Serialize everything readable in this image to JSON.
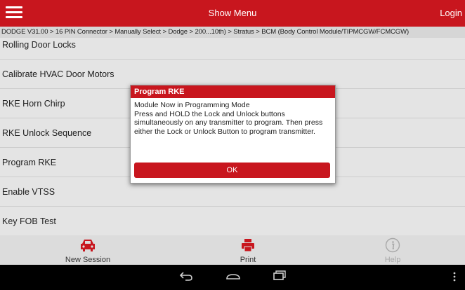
{
  "header": {
    "title": "Show Menu",
    "login_label": "Login"
  },
  "breadcrumb": "DODGE V31.00 > 16 PIN Connector > Manually Select > Dodge > 200...10th) > Stratus > BCM (Body Control Module/TIPMCGW/FCMCGW)",
  "menu_items": [
    {
      "label": "Rolling Door Locks"
    },
    {
      "label": "Calibrate HVAC Door Motors"
    },
    {
      "label": "RKE Horn Chirp"
    },
    {
      "label": "RKE Unlock Sequence"
    },
    {
      "label": "Program RKE"
    },
    {
      "label": "Enable VTSS"
    },
    {
      "label": "Key FOB Test"
    }
  ],
  "dialog": {
    "title": "Program RKE",
    "message_line1": "Module Now in Programming Mode",
    "message_line2": "Press and HOLD the Lock and Unlock buttons simultaneously on any transmitter to program. Then press either the Lock or Unlock Button to program transmitter.",
    "ok_label": "OK"
  },
  "bottom_bar": {
    "new_session_label": "New Session",
    "print_label": "Print",
    "help_label": "Help"
  },
  "icons": {
    "menu": "hamburger-icon",
    "new_session": "car-icon",
    "print": "printer-icon",
    "help": "info-icon",
    "back": "back-icon",
    "home": "home-icon",
    "recents": "recents-icon",
    "overflow": "overflow-icon"
  },
  "colors": {
    "accent": "#c8161e"
  }
}
